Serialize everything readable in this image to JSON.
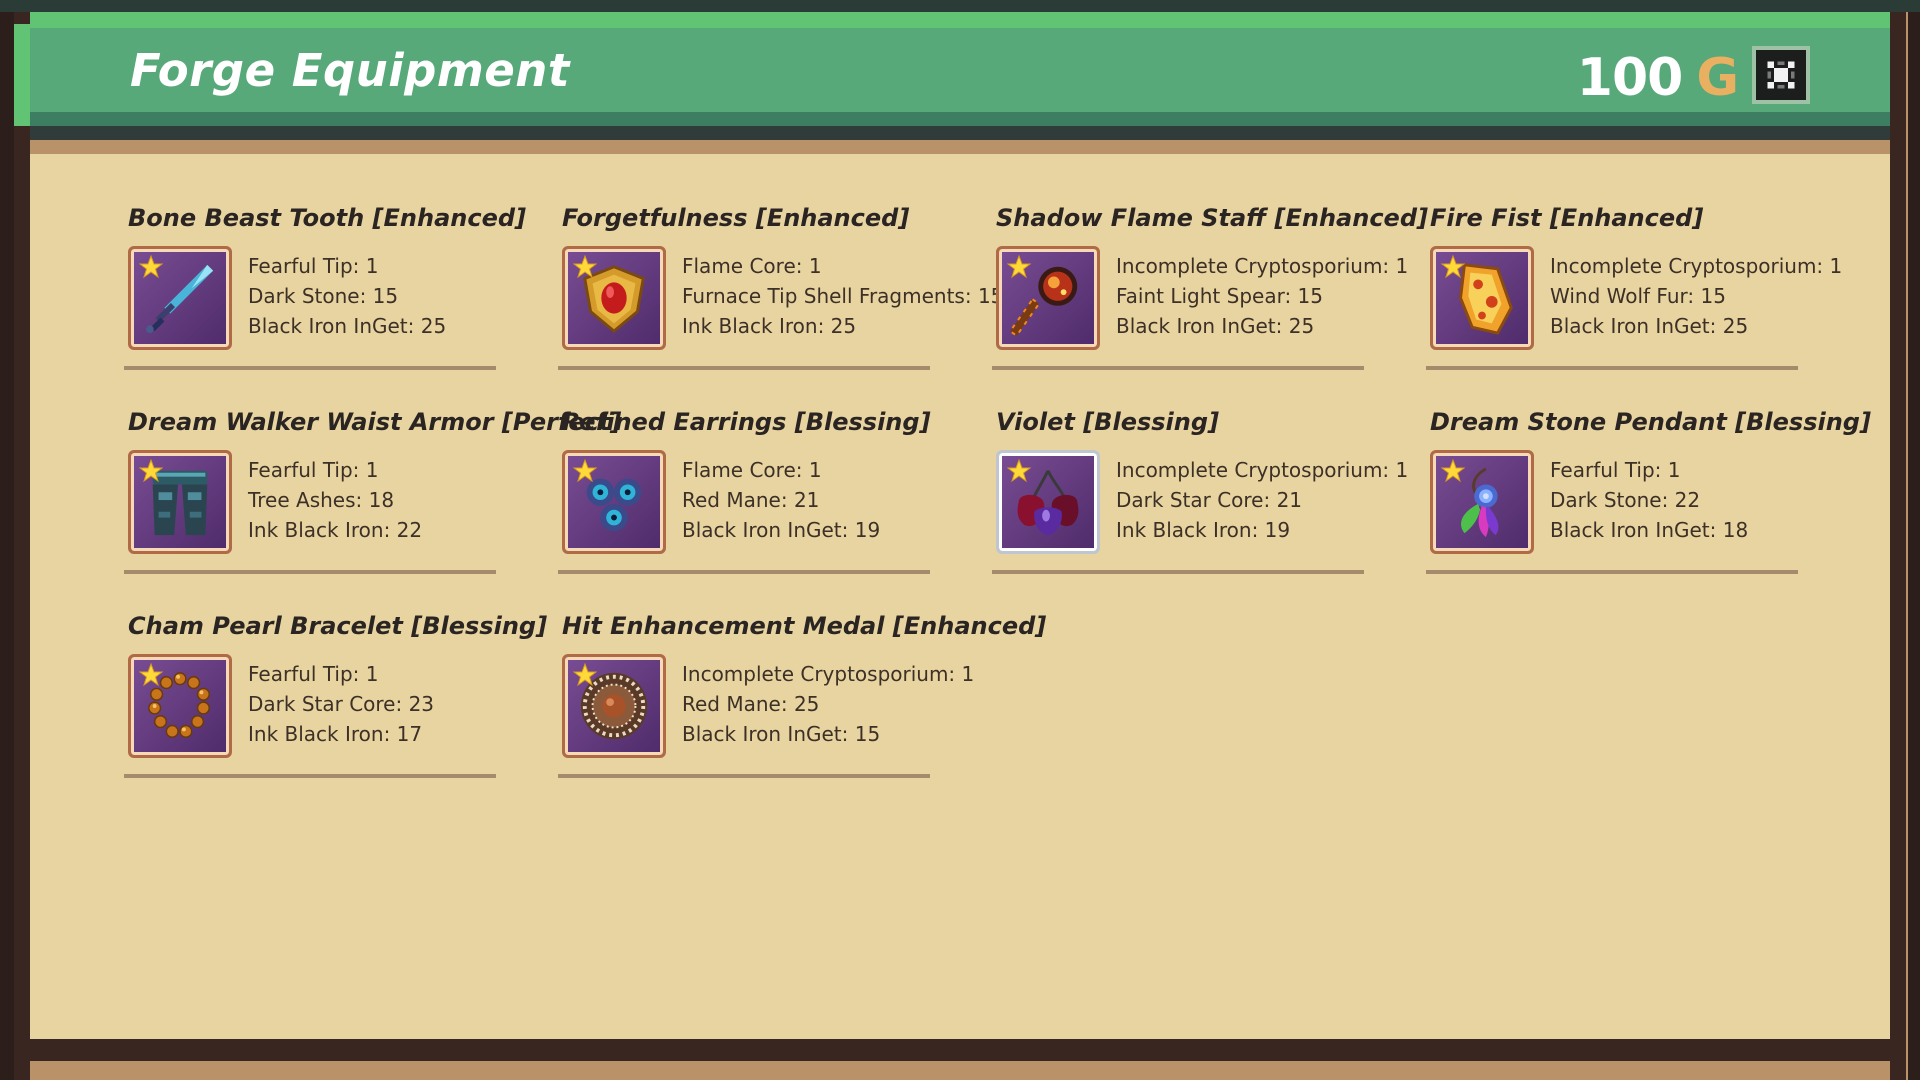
{
  "header": {
    "title": "Forge Equipment",
    "gold_amount": "100",
    "gold_unit": "G",
    "close_icon": "close-icon"
  },
  "items": [
    {
      "name": "Bone Beast Tooth [Enhanced]",
      "icon": "dagger-icon",
      "materials": [
        "Fearful Tip: 1",
        "Dark Stone: 15",
        "Black Iron InGet: 25"
      ]
    },
    {
      "name": "Forgetfulness [Enhanced]",
      "icon": "shield-icon",
      "materials": [
        "Flame Core: 1",
        "Furnace Tip Shell Fragments: 15",
        "Ink Black Iron: 25"
      ]
    },
    {
      "name": "Shadow Flame Staff [Enhanced]",
      "icon": "staff-icon",
      "materials": [
        "Incomplete Cryptosporium: 1",
        "Faint Light Spear: 15",
        "Black Iron InGet: 25"
      ]
    },
    {
      "name": "Fire Fist [Enhanced]",
      "icon": "fist-icon",
      "materials": [
        "Incomplete Cryptosporium: 1",
        "Wind Wolf Fur: 15",
        "Black Iron InGet: 25"
      ]
    },
    {
      "name": "Dream Walker Waist Armor [Perfect]",
      "icon": "leg-armor-icon",
      "materials": [
        "Fearful Tip: 1",
        "Tree Ashes: 18",
        "Ink Black Iron: 22"
      ]
    },
    {
      "name": "Refined Earrings [Blessing]",
      "icon": "earrings-icon",
      "materials": [
        "Flame Core: 1",
        "Red Mane: 21",
        "Black Iron InGet: 19"
      ]
    },
    {
      "name": "Violet [Blessing]",
      "icon": "violet-icon",
      "materials": [
        "Incomplete Cryptosporium: 1",
        "Dark Star Core: 21",
        "Ink Black Iron: 19"
      ]
    },
    {
      "name": "Dream Stone Pendant [Blessing]",
      "icon": "pendant-icon",
      "materials": [
        "Fearful Tip: 1",
        "Dark Stone: 22",
        "Black Iron InGet: 18"
      ]
    },
    {
      "name": "Cham Pearl Bracelet [Blessing]",
      "icon": "bracelet-icon",
      "materials": [
        "Fearful Tip: 1",
        "Dark Star Core: 23",
        "Ink Black Iron: 17"
      ]
    },
    {
      "name": "Hit Enhancement Medal [Enhanced]",
      "icon": "medal-icon",
      "materials": [
        "Incomplete Cryptosporium: 1",
        "Red Mane: 25",
        "Black Iron InGet: 15"
      ]
    }
  ],
  "colors": {
    "header_green": "#57a97a",
    "panel_beige": "#e8d4a1",
    "gold_accent": "#eab061",
    "icon_purple": "#5e3780"
  }
}
